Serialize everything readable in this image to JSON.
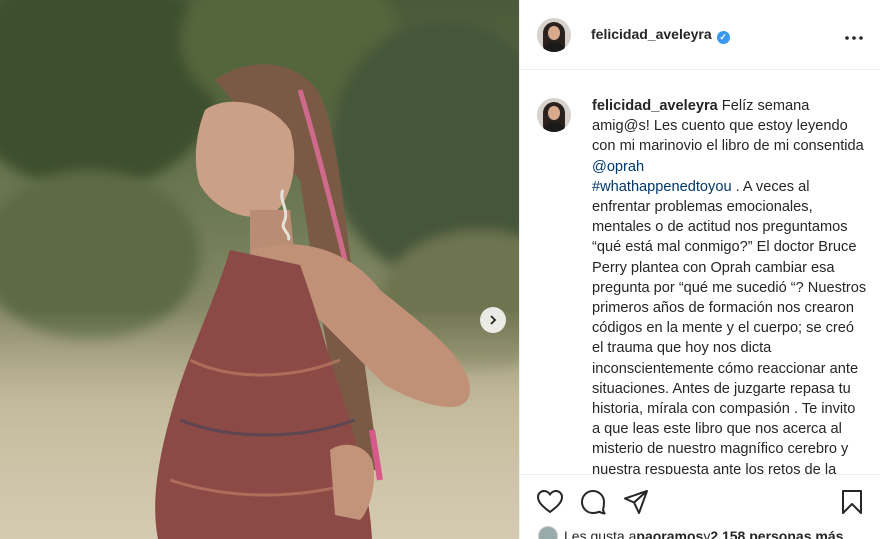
{
  "post": {
    "username": "felicidad_aveleyra",
    "verified_mark": "✓"
  },
  "caption": {
    "username": "felicidad_aveleyra",
    "text_1": " Felíz semana amig@s! Les cuento que estoy leyendo con mi marinovio el libro de mi consentida ",
    "mention": "@oprah",
    "hashtag": "#whathappenedtoyou",
    "text_2": " . A veces al enfrentar problemas emocionales, mentales o de actitud nos preguntamos “qué está mal conmigo?” El doctor Bruce Perry plantea con Oprah cambiar esa pregunta por “qué me sucedió “? Nuestros primeros años de formación nos crearon códigos en la mente y el cuerpo; se creó el trauma que hoy nos dicta inconscientemente cómo reaccionar ante situaciones. Antes de juzgarte repasa tu historia, mírala con compasión . Te invito a que leas este libro que nos acerca al misterio de nuestro magnífico cerebro y nuestra respuesta ante los retos de la vida."
  },
  "likes": {
    "prefix": "Les gusta a ",
    "user": "paoramos",
    "middle": " y ",
    "count": "2.158 personas más"
  },
  "icons": {
    "more": "more-options-icon",
    "like": "heart-icon",
    "comment": "comment-icon",
    "share": "share-icon",
    "save": "bookmark-icon",
    "next": "chevron-right-icon"
  },
  "colors": {
    "verified": "#3897f0",
    "link": "#00376b",
    "text": "#262626",
    "border": "#efefef"
  }
}
